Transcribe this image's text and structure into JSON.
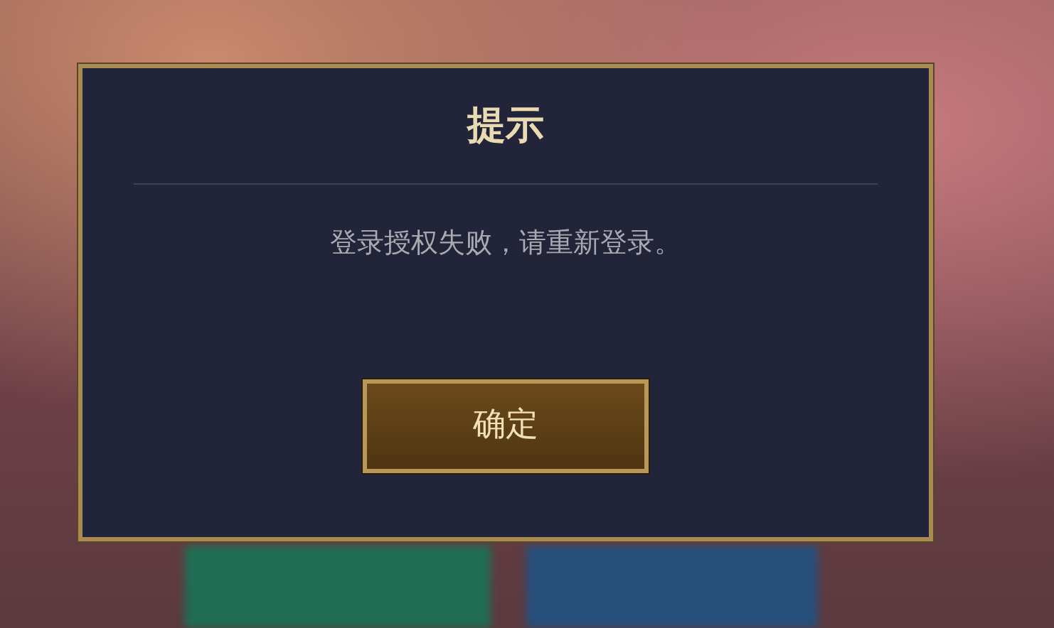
{
  "dialog": {
    "title": "提示",
    "message": "登录授权失败，请重新登录。",
    "buttons": [
      "确定"
    ]
  }
}
